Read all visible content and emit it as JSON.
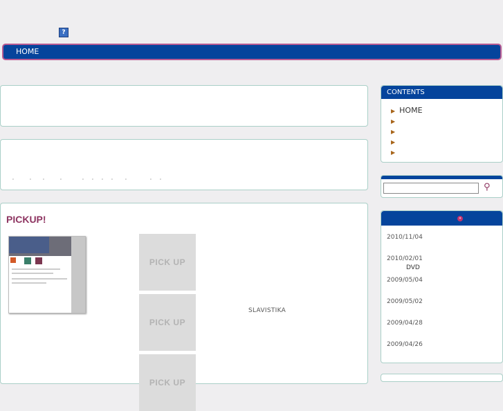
{
  "header": {
    "help_icon": "?"
  },
  "nav": {
    "home": "HOME"
  },
  "pickup": {
    "title": "PICKUP!",
    "pick_label": "PICK UP",
    "item_name": "SLAVISTIKA"
  },
  "sidebar": {
    "contents_title": "CONTENTS",
    "items": [
      {
        "label": "HOME"
      },
      {
        "label": ""
      },
      {
        "label": ""
      },
      {
        "label": ""
      },
      {
        "label": ""
      }
    ]
  },
  "search": {
    "value": "",
    "icon": "search-icon"
  },
  "news": {
    "entries": [
      {
        "date": "2010/11/04",
        "text": ""
      },
      {
        "date": "2010/02/01",
        "text": "DVD"
      },
      {
        "date": "2009/05/04",
        "text": ""
      },
      {
        "date": "2009/05/02",
        "text": ""
      },
      {
        "date": "2009/04/28",
        "text": ""
      },
      {
        "date": "2009/04/26",
        "text": ""
      }
    ]
  },
  "colors": {
    "nav": "#05449c",
    "accent": "#8e3561",
    "border": "#a9cfc7"
  }
}
